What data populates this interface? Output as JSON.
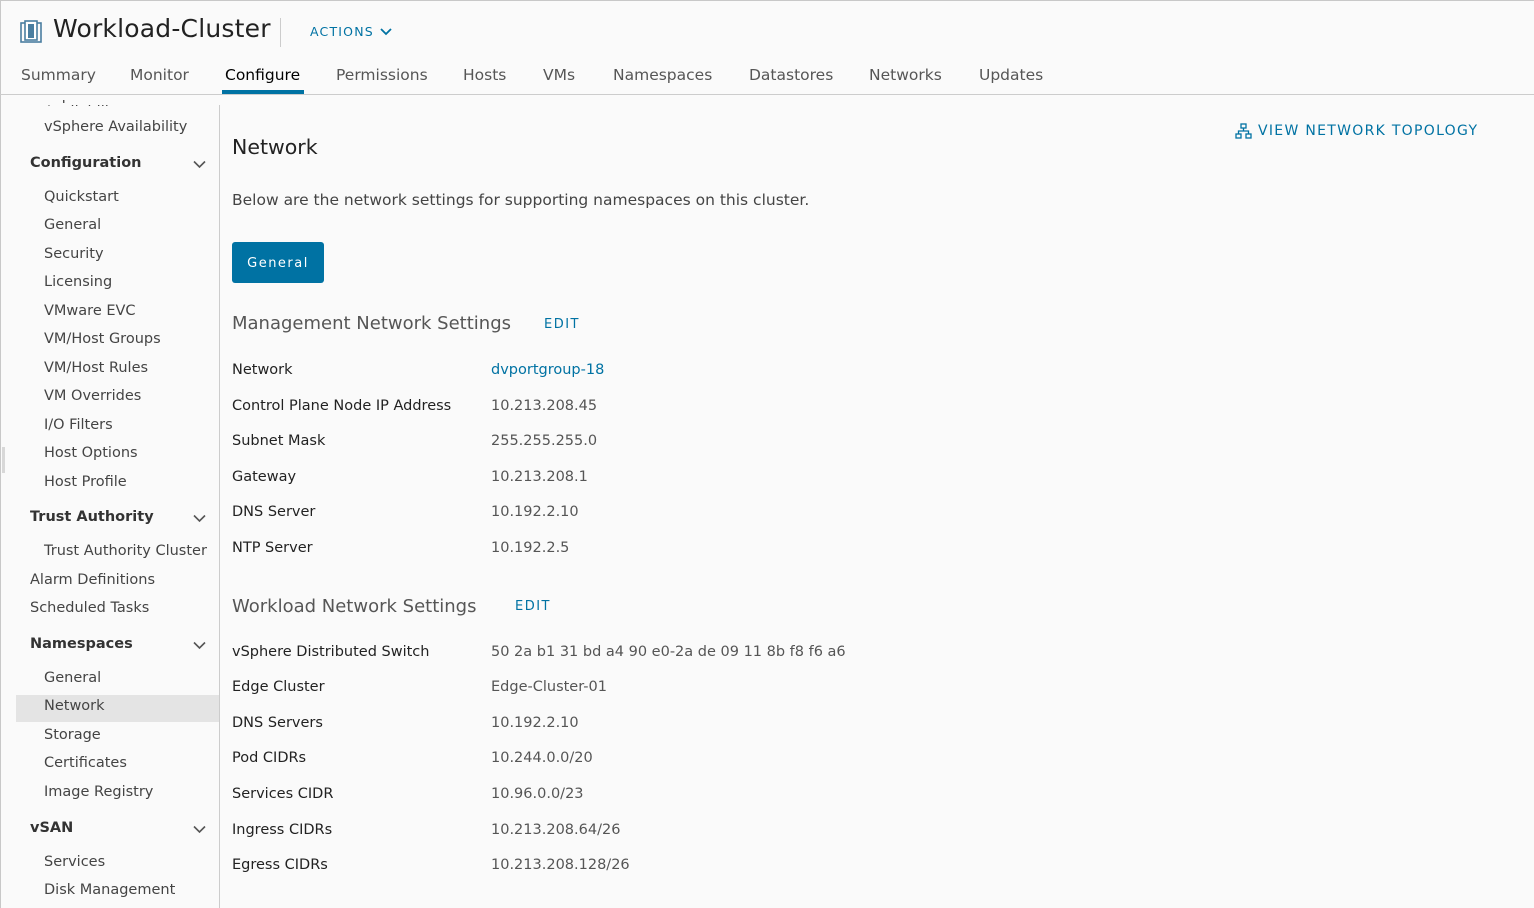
{
  "header": {
    "title": "Workload-Cluster",
    "actions_label": "ACTIONS"
  },
  "tabs": [
    {
      "label": "Summary"
    },
    {
      "label": "Monitor"
    },
    {
      "label": "Configure",
      "active": true
    },
    {
      "label": "Permissions"
    },
    {
      "label": "Hosts"
    },
    {
      "label": "VMs"
    },
    {
      "label": "Namespaces"
    },
    {
      "label": "Datastores"
    },
    {
      "label": "Networks"
    },
    {
      "label": "Updates"
    }
  ],
  "sidebar": {
    "vsphere_availability": "vSphere Availability",
    "configuration": {
      "label": "Configuration",
      "items": [
        "Quickstart",
        "General",
        "Security",
        "Licensing",
        "VMware EVC",
        "VM/Host Groups",
        "VM/Host Rules",
        "VM Overrides",
        "I/O Filters",
        "Host Options",
        "Host Profile"
      ]
    },
    "trust_authority": {
      "label": "Trust Authority",
      "items": [
        "Trust Authority Cluster"
      ]
    },
    "alarm_definitions": "Alarm Definitions",
    "scheduled_tasks": "Scheduled Tasks",
    "namespaces": {
      "label": "Namespaces",
      "items": [
        "General",
        "Network",
        "Storage",
        "Certificates",
        "Image Registry"
      ],
      "active_item": "Network"
    },
    "vsan": {
      "label": "vSAN",
      "items": [
        "Services",
        "Disk Management"
      ]
    }
  },
  "main": {
    "topology_label": "VIEW NETWORK TOPOLOGY",
    "title": "Network",
    "description": "Below are the network settings for supporting namespaces on this cluster.",
    "general_button": "General",
    "edit_label": "EDIT",
    "management": {
      "title": "Management Network Settings",
      "rows": [
        {
          "label": "Network",
          "value": "dvportgroup-18"
        },
        {
          "label": "Control Plane Node IP Address",
          "value": "10.213.208.45"
        },
        {
          "label": "Subnet Mask",
          "value": "255.255.255.0"
        },
        {
          "label": "Gateway",
          "value": "10.213.208.1"
        },
        {
          "label": "DNS Server",
          "value": "10.192.2.10"
        },
        {
          "label": "NTP Server",
          "value": "10.192.2.5"
        }
      ]
    },
    "workload": {
      "title": "Workload Network Settings",
      "rows": [
        {
          "label": "vSphere Distributed Switch",
          "value": "50 2a b1 31 bd a4 90 e0-2a de 09 11 8b f8 f6 a6"
        },
        {
          "label": "Edge Cluster",
          "value": "Edge-Cluster-01"
        },
        {
          "label": "DNS Servers",
          "value": "10.192.2.10"
        },
        {
          "label": "Pod CIDRs",
          "value": "10.244.0.0/20"
        },
        {
          "label": "Services CIDR",
          "value": "10.96.0.0/23"
        },
        {
          "label": "Ingress CIDRs",
          "value": "10.213.208.64/26"
        },
        {
          "label": "Egress CIDRs",
          "value": "10.213.208.128/26"
        }
      ]
    }
  },
  "colors": {
    "accent": "#0072a3",
    "active_sidebar_bg": "#e4e4e4",
    "page_bg": "#fafafa"
  }
}
